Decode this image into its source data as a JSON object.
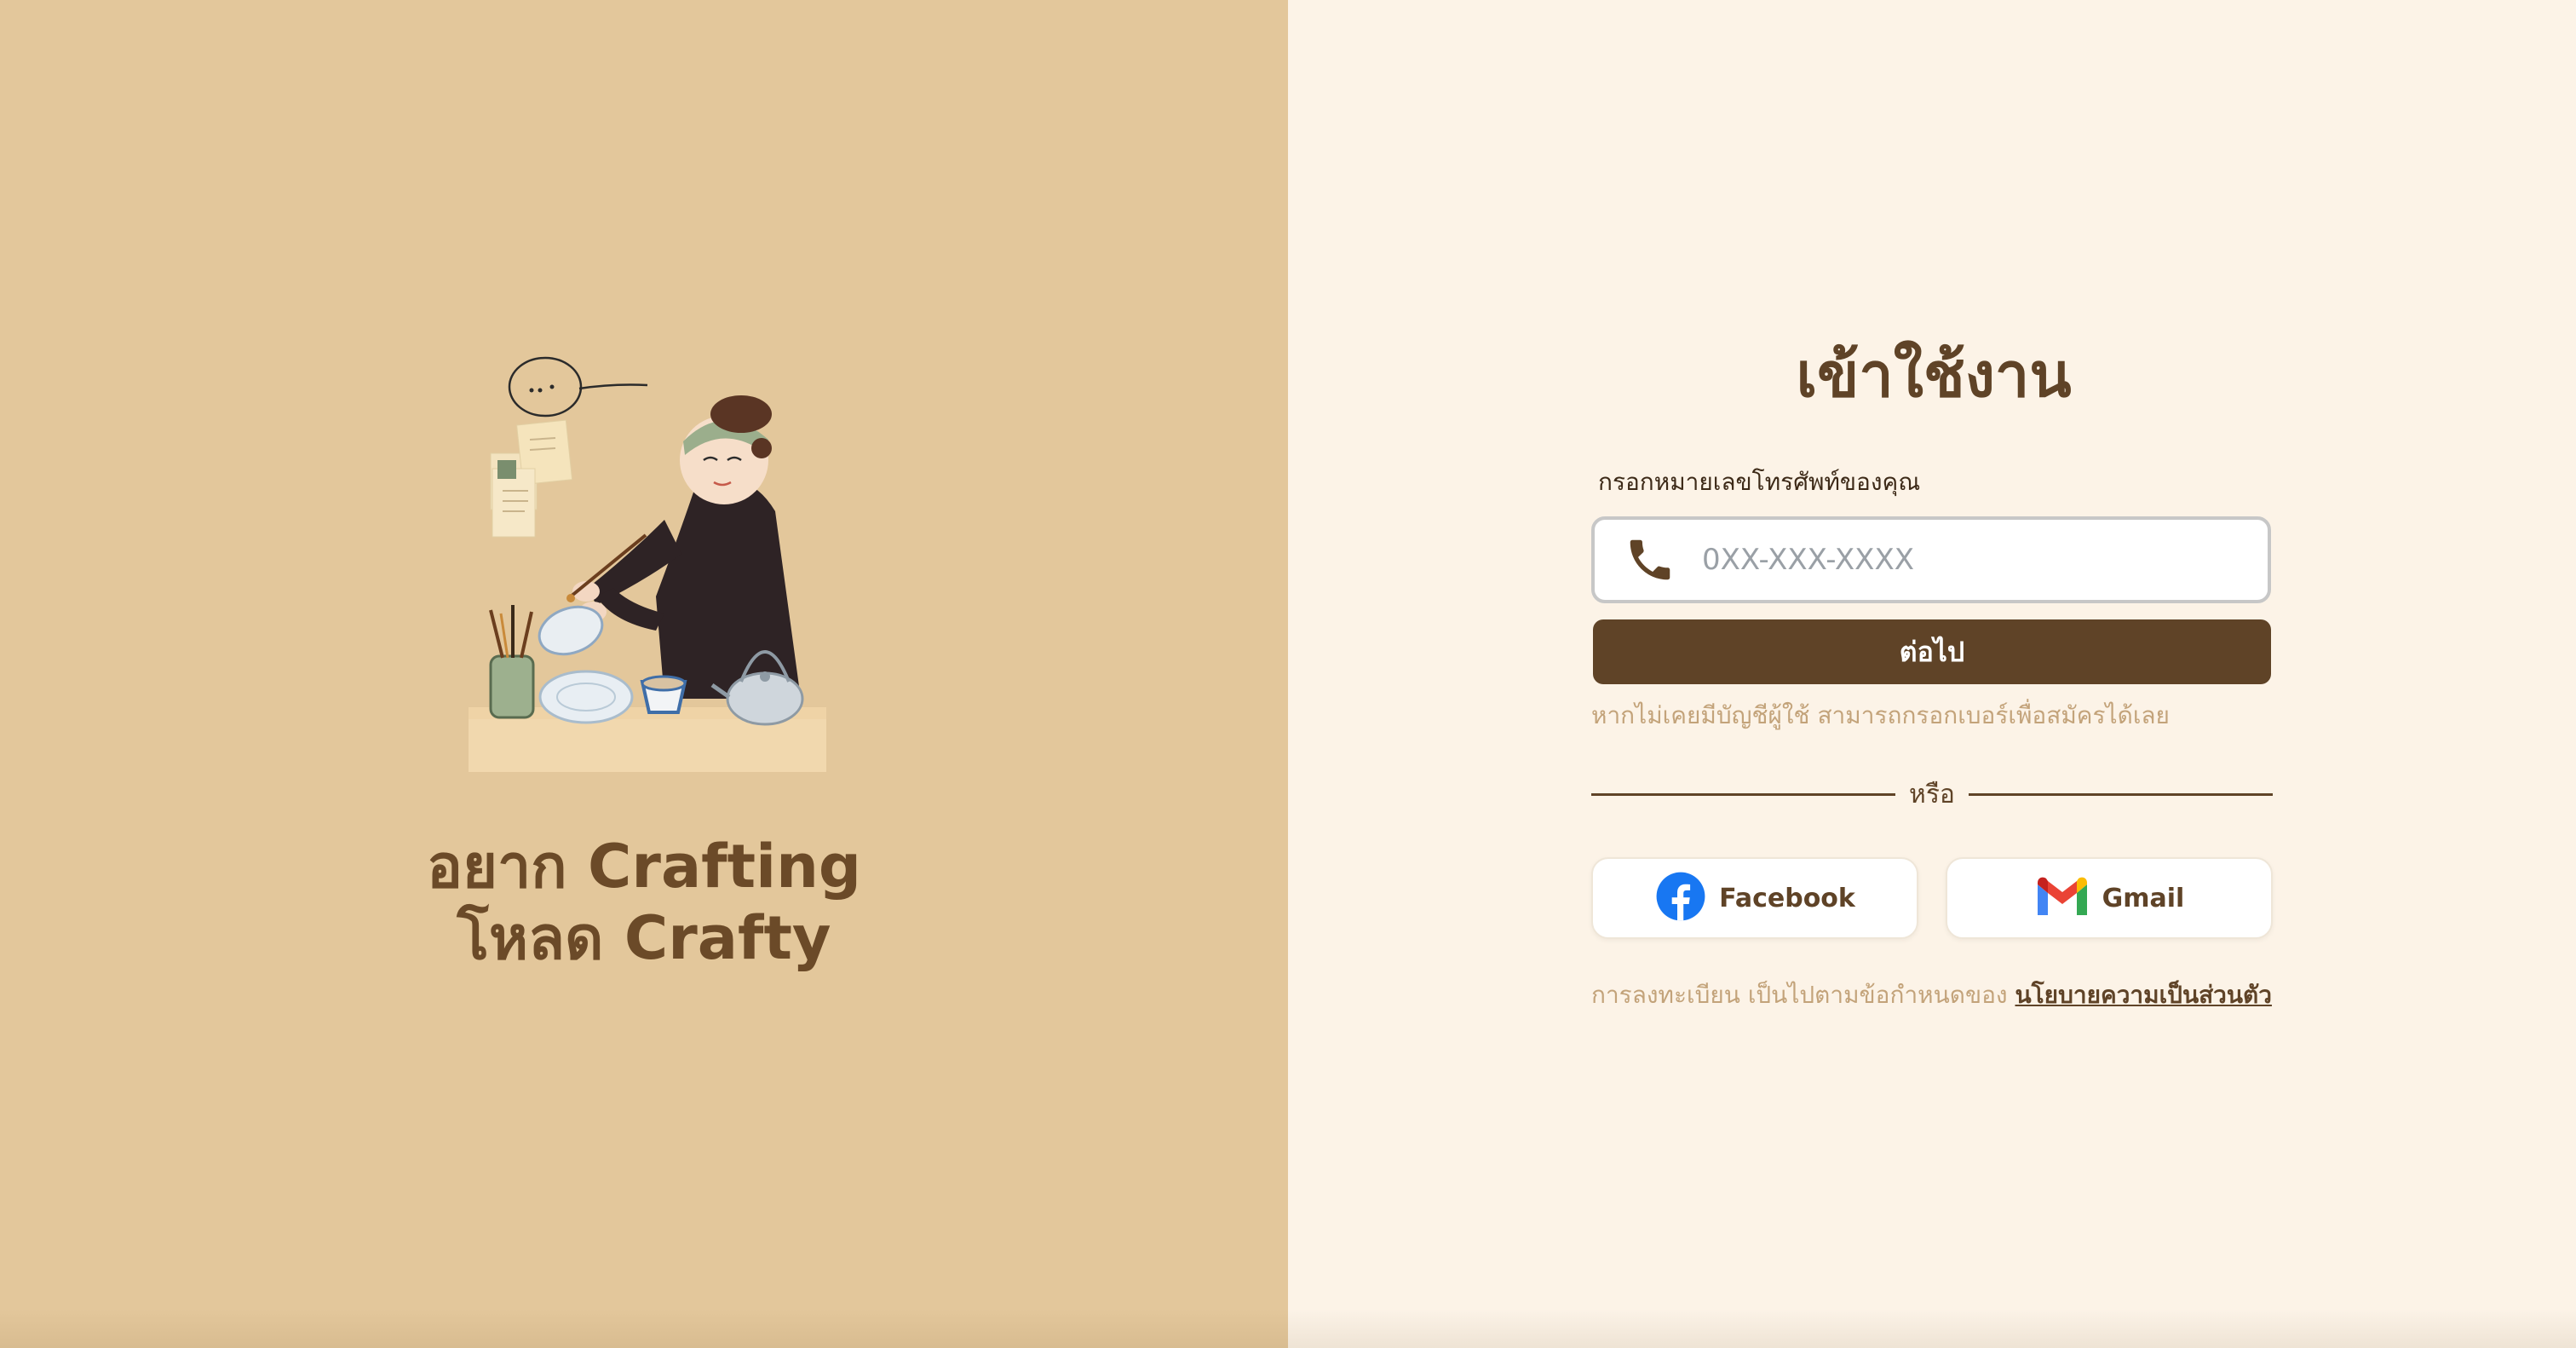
{
  "left": {
    "tagline_line1": "อยาก Crafting",
    "tagline_line2": "โหลด Crafty",
    "illustration": "artisan-painting-pottery-illustration",
    "background_color": "#E3C79B"
  },
  "login": {
    "title": "เข้าใช้งาน",
    "phone_label": "กรอกหมายเลขโทรศัพท์ของคุณ",
    "phone_placeholder": "0XX-XXX-XXXX",
    "phone_value": "",
    "phone_icon": "phone-icon",
    "next_label": "ต่อไป",
    "hint": "หากไม่เคยมีบัญชีผู้ใช้ สามารถกรอกเบอร์เพื่อสมัครได้เลย",
    "divider_text": "หรือ",
    "facebook_label": "Facebook",
    "facebook_icon": "facebook-icon",
    "gmail_label": "Gmail",
    "gmail_icon": "gmail-icon",
    "policy_text": "การลงทะเบียน เป็นไปตามข้อกำหนดของ",
    "policy_link": "นโยบายความเป็นส่วนตัว"
  },
  "colors": {
    "brand_brown": "#5F4327",
    "left_bg": "#E3C79B",
    "right_bg": "#FCF3E7",
    "muted_text": "#C3A37A"
  }
}
